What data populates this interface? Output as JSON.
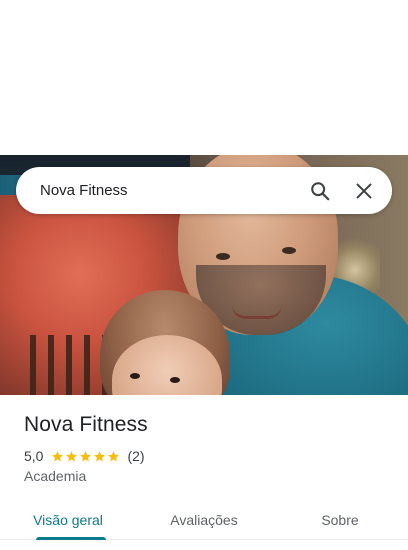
{
  "search": {
    "value": "Nova Fitness",
    "placeholder": ""
  },
  "icons": {
    "search": "search-icon",
    "close": "close-icon",
    "star": "star-icon"
  },
  "place": {
    "name": "Nova Fitness",
    "rating_text": "5,0",
    "rating_value": 5.0,
    "stars_filled": 5,
    "review_count": "(2)",
    "category": "Academia"
  },
  "tabs": [
    {
      "label": "Visão geral",
      "active": true
    },
    {
      "label": "Avaliações",
      "active": false
    },
    {
      "label": "Sobre",
      "active": false
    }
  ],
  "colors": {
    "accent": "#0b7a8a",
    "star": "#fbbc04",
    "text_primary": "#202124",
    "text_secondary": "#5f6368"
  }
}
